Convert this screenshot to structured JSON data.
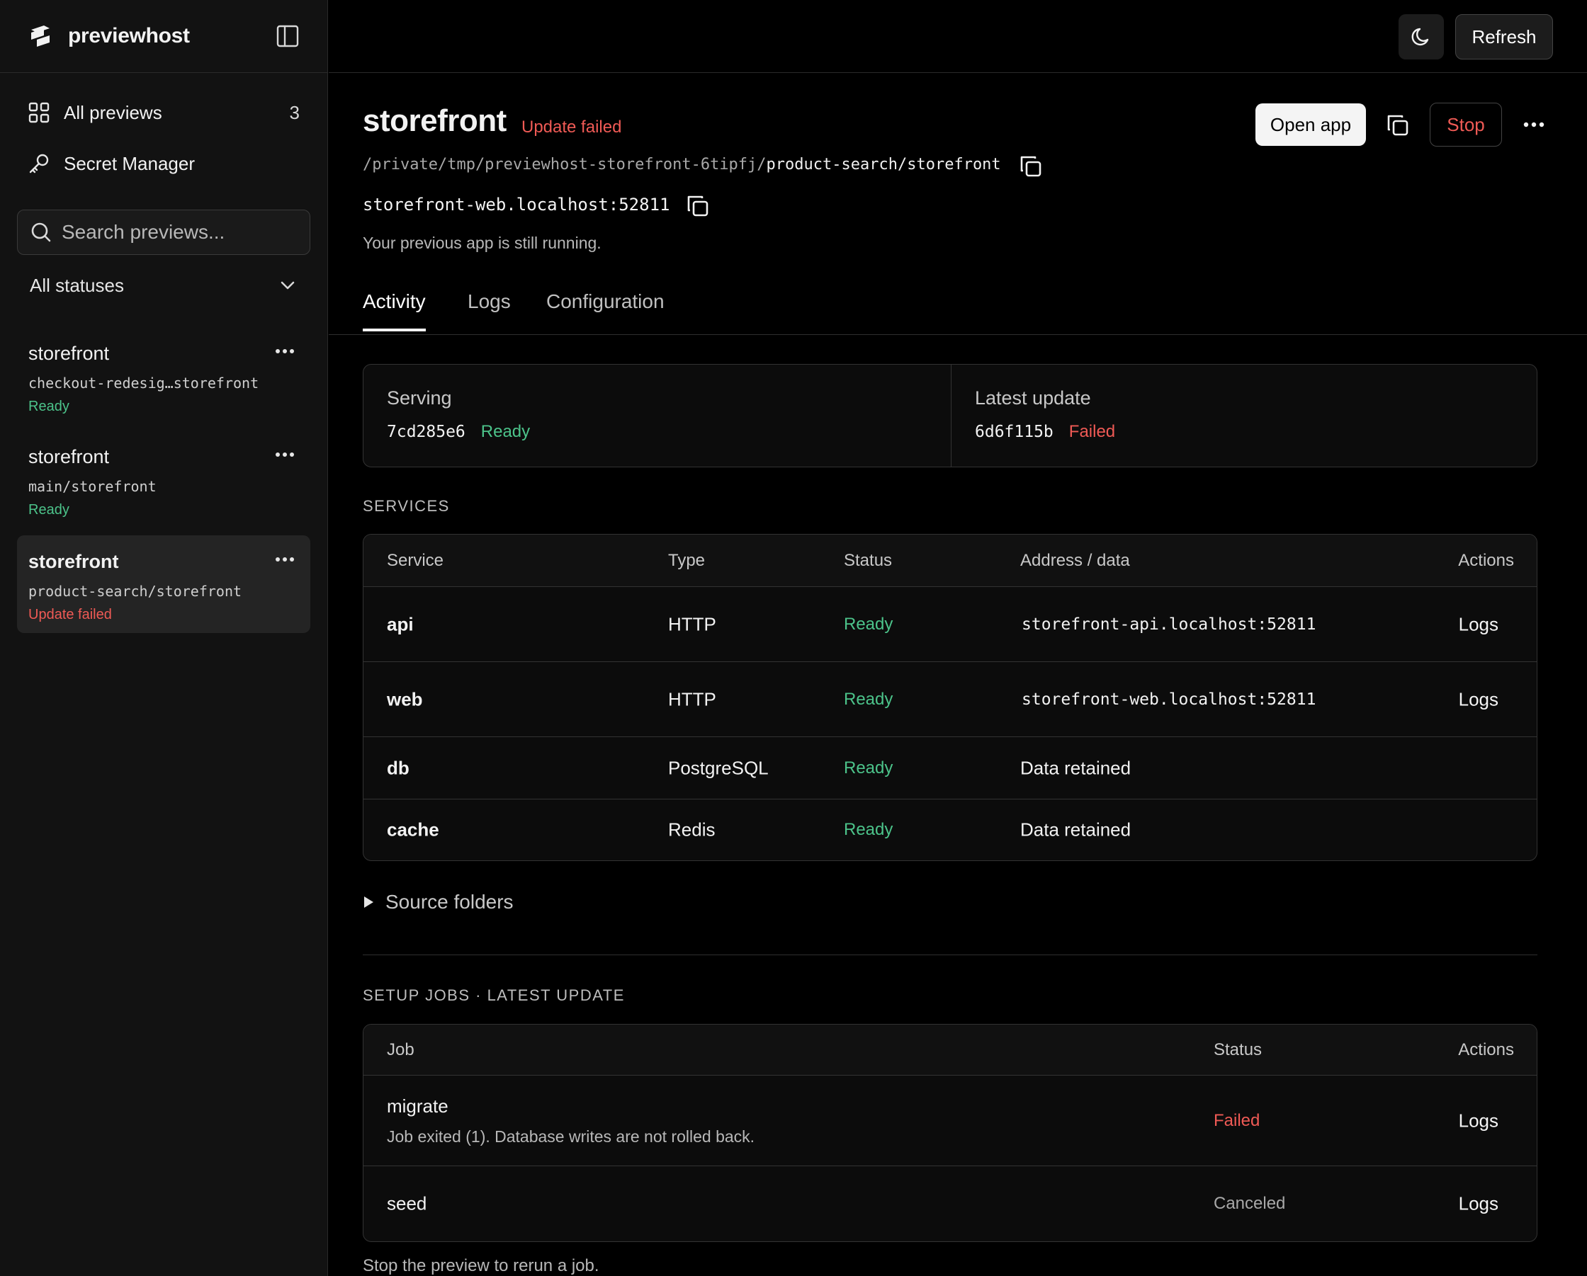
{
  "app": {
    "brand": "previewhost"
  },
  "sidebar": {
    "nav": [
      {
        "label": "All previews",
        "count": "3"
      },
      {
        "label": "Secret Manager"
      }
    ],
    "search": {
      "placeholder": "Search previews..."
    },
    "status_filter": {
      "value": "All statuses"
    },
    "previews": [
      {
        "title": "storefront",
        "branch": "checkout-redesig…storefront",
        "status": "Ready"
      },
      {
        "title": "storefront",
        "branch": "main/storefront",
        "status": "Ready"
      },
      {
        "title": "storefront",
        "branch": "product-search/storefront",
        "status": "Update failed"
      }
    ]
  },
  "topbar": {
    "refresh_label": "Refresh"
  },
  "detail": {
    "title": "storefront",
    "status": "Update failed",
    "open_label": "Open app",
    "stop_label": "Stop",
    "path_prefix": "/private/tmp/previewhost-storefront-6tipfj/",
    "path_suffix": "product-search/storefront",
    "host": "storefront-web.localhost:52811",
    "note": "Your previous app is still running."
  },
  "tabs": [
    "Activity",
    "Logs",
    "Configuration"
  ],
  "summary": {
    "serving": {
      "label": "Serving",
      "commit": "7cd285e6",
      "status": "Ready"
    },
    "latest": {
      "label": "Latest update",
      "commit": "6d6f115b",
      "status": "Failed"
    }
  },
  "services": {
    "heading": "SERVICES",
    "columns": [
      "Service",
      "Type",
      "Status",
      "Address / data",
      "Actions"
    ],
    "rows": [
      {
        "service": "api",
        "type": "HTTP",
        "status": "Ready",
        "address": "storefront-api.localhost:52811",
        "action": "Logs"
      },
      {
        "service": "web",
        "type": "HTTP",
        "status": "Ready",
        "address": "storefront-web.localhost:52811",
        "action": "Logs"
      },
      {
        "service": "db",
        "type": "PostgreSQL",
        "status": "Ready",
        "address": "Data retained",
        "action": ""
      },
      {
        "service": "cache",
        "type": "Redis",
        "status": "Ready",
        "address": "Data retained",
        "action": ""
      }
    ]
  },
  "source_folders": "Source folders",
  "jobs": {
    "heading": "SETUP JOBS · LATEST UPDATE",
    "columns": [
      "Job",
      "Status",
      "Actions"
    ],
    "rows": [
      {
        "job": "migrate",
        "detail": "Job exited (1). Database writes are not rolled back.",
        "status": "Failed",
        "action": "Logs"
      },
      {
        "job": "seed",
        "detail": "",
        "status": "Canceled",
        "action": "Logs"
      }
    ],
    "footer": "Stop the preview to rerun a job."
  }
}
